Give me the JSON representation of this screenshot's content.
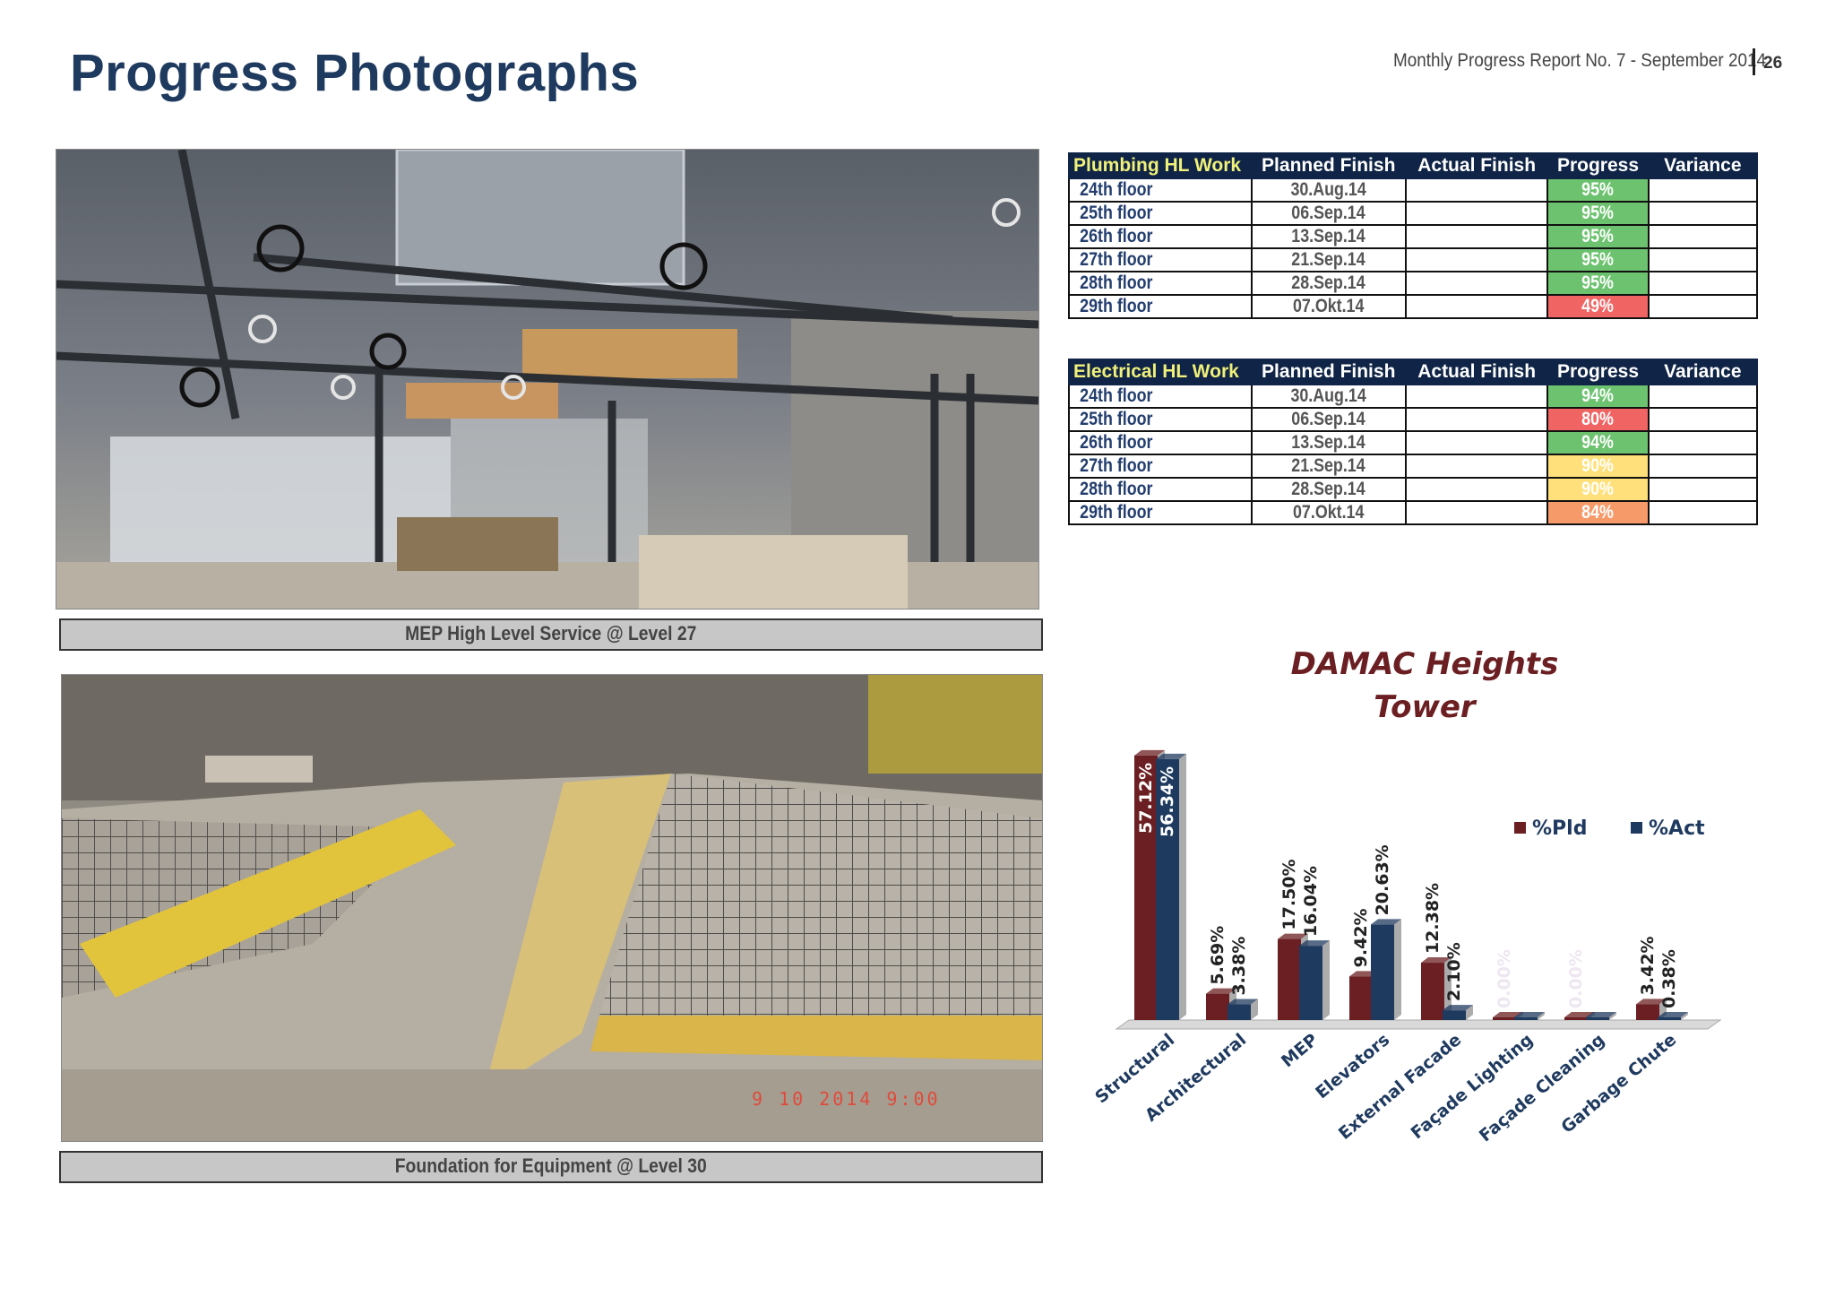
{
  "page": {
    "title": "Progress Photographs",
    "report": "Monthly Progress Report No. 7 - September 2014",
    "page_number": "26"
  },
  "photos": [
    {
      "caption": "MEP High Level Service @ Level 27"
    },
    {
      "caption": "Foundation for Equipment @ Level 30",
      "timestamp": "9 10 2014   9:00"
    }
  ],
  "tables": [
    {
      "header": [
        "Plumbing HL Work",
        "Planned Finish",
        "Actual Finish",
        "Progress",
        "Variance"
      ],
      "rows": [
        {
          "floor": "24th floor",
          "planned": "30.Aug.14",
          "actual": "",
          "progress": "95%",
          "status": "green",
          "variance": ""
        },
        {
          "floor": "25th floor",
          "planned": "06.Sep.14",
          "actual": "",
          "progress": "95%",
          "status": "green",
          "variance": ""
        },
        {
          "floor": "26th floor",
          "planned": "13.Sep.14",
          "actual": "",
          "progress": "95%",
          "status": "green",
          "variance": ""
        },
        {
          "floor": "27th floor",
          "planned": "21.Sep.14",
          "actual": "",
          "progress": "95%",
          "status": "green",
          "variance": ""
        },
        {
          "floor": "28th floor",
          "planned": "28.Sep.14",
          "actual": "",
          "progress": "95%",
          "status": "green",
          "variance": ""
        },
        {
          "floor": "29th floor",
          "planned": "07.Okt.14",
          "actual": "",
          "progress": "49%",
          "status": "red",
          "variance": ""
        }
      ]
    },
    {
      "header": [
        "Electrical HL Work",
        "Planned Finish",
        "Actual Finish",
        "Progress",
        "Variance"
      ],
      "rows": [
        {
          "floor": "24th floor",
          "planned": "30.Aug.14",
          "actual": "",
          "progress": "94%",
          "status": "green",
          "variance": ""
        },
        {
          "floor": "25th floor",
          "planned": "06.Sep.14",
          "actual": "",
          "progress": "80%",
          "status": "red",
          "variance": ""
        },
        {
          "floor": "26th floor",
          "planned": "13.Sep.14",
          "actual": "",
          "progress": "94%",
          "status": "green",
          "variance": ""
        },
        {
          "floor": "27th floor",
          "planned": "21.Sep.14",
          "actual": "",
          "progress": "90%",
          "status": "yellow",
          "variance": ""
        },
        {
          "floor": "28th floor",
          "planned": "28.Sep.14",
          "actual": "",
          "progress": "90%",
          "status": "yellow",
          "variance": ""
        },
        {
          "floor": "29th floor",
          "planned": "07.Okt.14",
          "actual": "",
          "progress": "84%",
          "status": "orange",
          "variance": ""
        }
      ]
    }
  ],
  "colors": {
    "title": "#1f3a5f",
    "header_bg": "#0f2446",
    "planned": "#6b1f22",
    "actual": "#1f3a5f",
    "green": "#6cc26f",
    "red": "#f06464",
    "yellow": "#ffe07a",
    "orange": "#f79a6a"
  },
  "chart_data": {
    "type": "bar",
    "title": "DAMAC Heights Tower",
    "title_lines": [
      "DAMAC Heights",
      "Tower"
    ],
    "categories": [
      "Structural",
      "Architectural",
      "MEP",
      "Elevators",
      "External Facade",
      "Façade Lighting",
      "Façade Cleaning",
      "Garbage Chute"
    ],
    "series": [
      {
        "name": "%Pld",
        "values": [
          57.12,
          5.69,
          17.5,
          9.42,
          12.38,
          0.0,
          0.0,
          3.42
        ],
        "labels": [
          "57.12%",
          "5.69%",
          "17.50%",
          "9.42%",
          "12.38%",
          "0.00%",
          "0.00%",
          "3.42%"
        ]
      },
      {
        "name": "%Act",
        "values": [
          56.34,
          3.38,
          16.04,
          20.63,
          2.1,
          0.0,
          0.0,
          0.38
        ],
        "labels": [
          "56.34%",
          "3.38%",
          "16.04%",
          "20.63%",
          "2.10%",
          "",
          "",
          "0.38%"
        ]
      }
    ],
    "legend_position": "top-right",
    "grid": false,
    "ylim": [
      0,
      60
    ]
  }
}
